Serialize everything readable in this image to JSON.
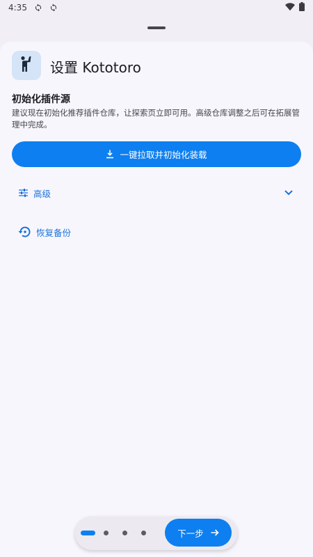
{
  "status_bar": {
    "time": "4:35"
  },
  "header": {
    "title": "设置 Kototoro"
  },
  "section": {
    "title": "初始化插件源",
    "description": "建议现在初始化推荐插件仓库，让探索页立即可用。高级仓库调整之后可在拓展管理中完成。"
  },
  "primary_button": {
    "label": "一键拉取并初始化装载"
  },
  "advanced": {
    "label": "高级"
  },
  "restore": {
    "label": "恢复备份"
  },
  "bottom_nav": {
    "next_label": "下一步",
    "page_count": 4,
    "current_page": 1
  },
  "colors": {
    "accent": "#0d7ff0",
    "link": "#1a73d9",
    "icon_bg": "#d5e4f7"
  }
}
